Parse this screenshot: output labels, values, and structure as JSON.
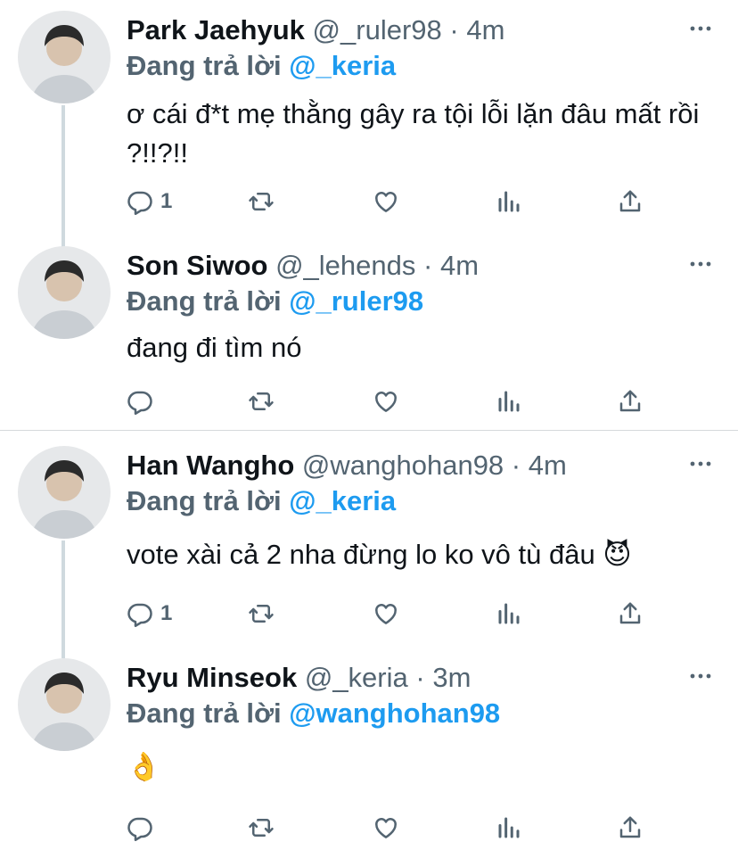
{
  "colors": {
    "accent": "#1d9bf0",
    "muted": "#536471",
    "text": "#0f1419",
    "thread_line": "#cfd9de"
  },
  "replying_label": "Đang trả lời",
  "tweets": [
    {
      "name": "Park Jaehyuk",
      "handle": "@_ruler98",
      "dot": "·",
      "time": "4m",
      "reply_to": "@_keria",
      "text": "ơ cái đ*t mẹ thằng gây ra tội lỗi lặn đâu mất rồi ?!!?!!",
      "reply_count": "1",
      "icons": [
        "reply-icon",
        "retweet-icon",
        "like-icon",
        "analytics-icon",
        "share-icon",
        "more-icon"
      ]
    },
    {
      "name": "Son Siwoo",
      "handle": "@_lehends",
      "dot": "·",
      "time": "4m",
      "reply_to": "@_ruler98",
      "text": "đang đi tìm nó",
      "reply_count": "",
      "icons": [
        "reply-icon",
        "retweet-icon",
        "like-icon",
        "analytics-icon",
        "share-icon",
        "more-icon"
      ]
    },
    {
      "name": "Han Wangho",
      "handle": "@wanghohan98",
      "dot": "·",
      "time": "4m",
      "reply_to": "@_keria",
      "text": "vote xài cả 2 nha đừng lo ko vô tù đâu 😈",
      "reply_count": "1",
      "icons": [
        "reply-icon",
        "retweet-icon",
        "like-icon",
        "analytics-icon",
        "share-icon",
        "more-icon"
      ]
    },
    {
      "name": "Ryu Minseok",
      "handle": "@_keria",
      "dot": "·",
      "time": "3m",
      "reply_to": "@wanghohan98",
      "text": "👌",
      "reply_count": "",
      "icons": [
        "reply-icon",
        "retweet-icon",
        "like-icon",
        "analytics-icon",
        "share-icon",
        "more-icon"
      ]
    }
  ]
}
